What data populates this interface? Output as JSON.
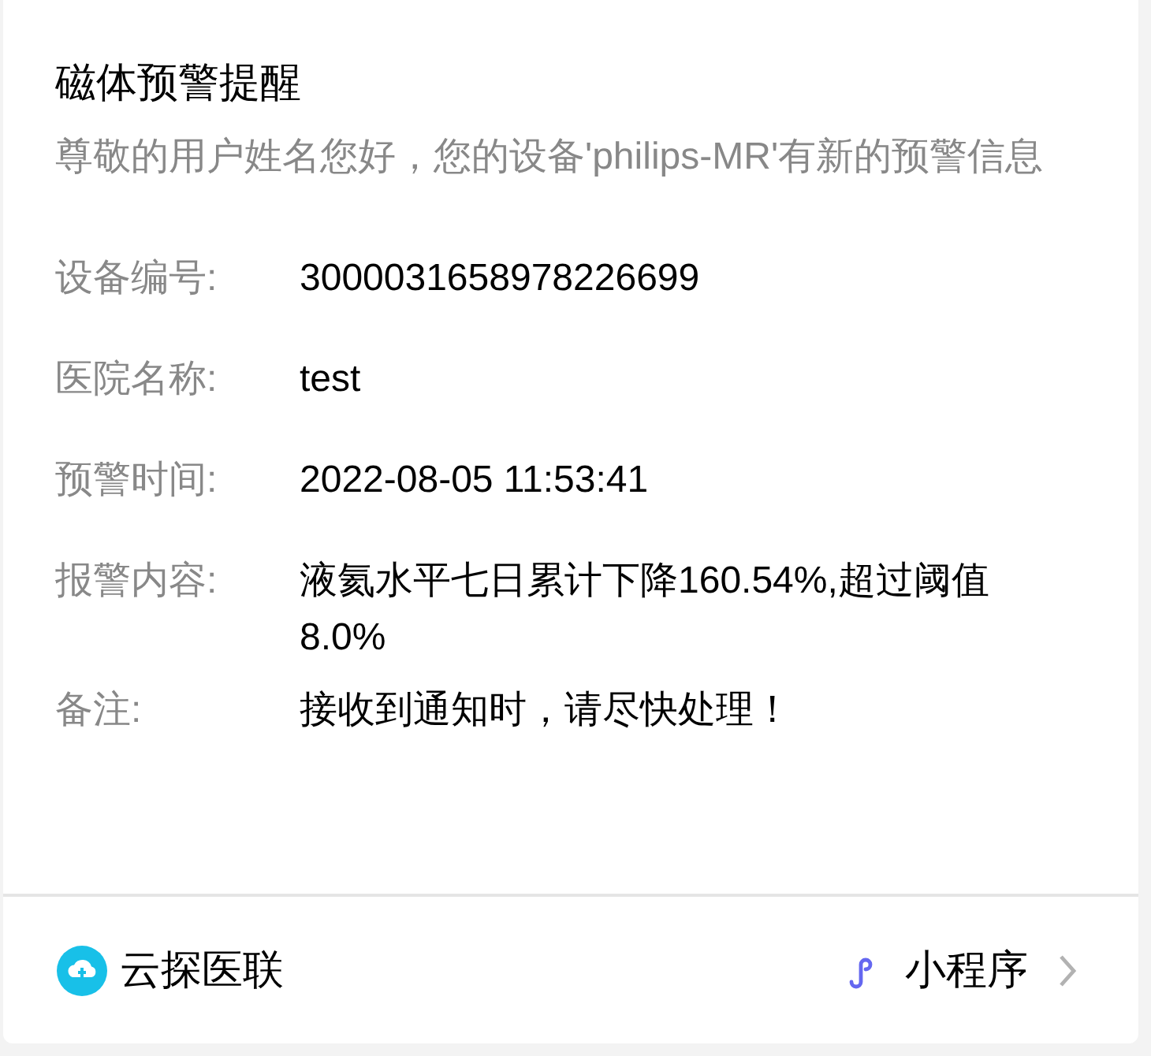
{
  "card": {
    "title": "磁体预警提醒",
    "subtitle": "尊敬的用户姓名您好，您的设备'philips-MR'有新的预警信息",
    "fields": [
      {
        "label": "设备编号:",
        "value": "3000031658978226699"
      },
      {
        "label": "医院名称:",
        "value": "test"
      },
      {
        "label": "预警时间:",
        "value": "2022-08-05 11:53:41"
      },
      {
        "label": "报警内容:",
        "value": "液氦水平七日累计下降160.54%,超过阈值8.0%"
      },
      {
        "label": "备注:",
        "value": "接收到通知时，请尽快处理！"
      }
    ]
  },
  "footer": {
    "account": "云探医联",
    "link": "小程序"
  }
}
